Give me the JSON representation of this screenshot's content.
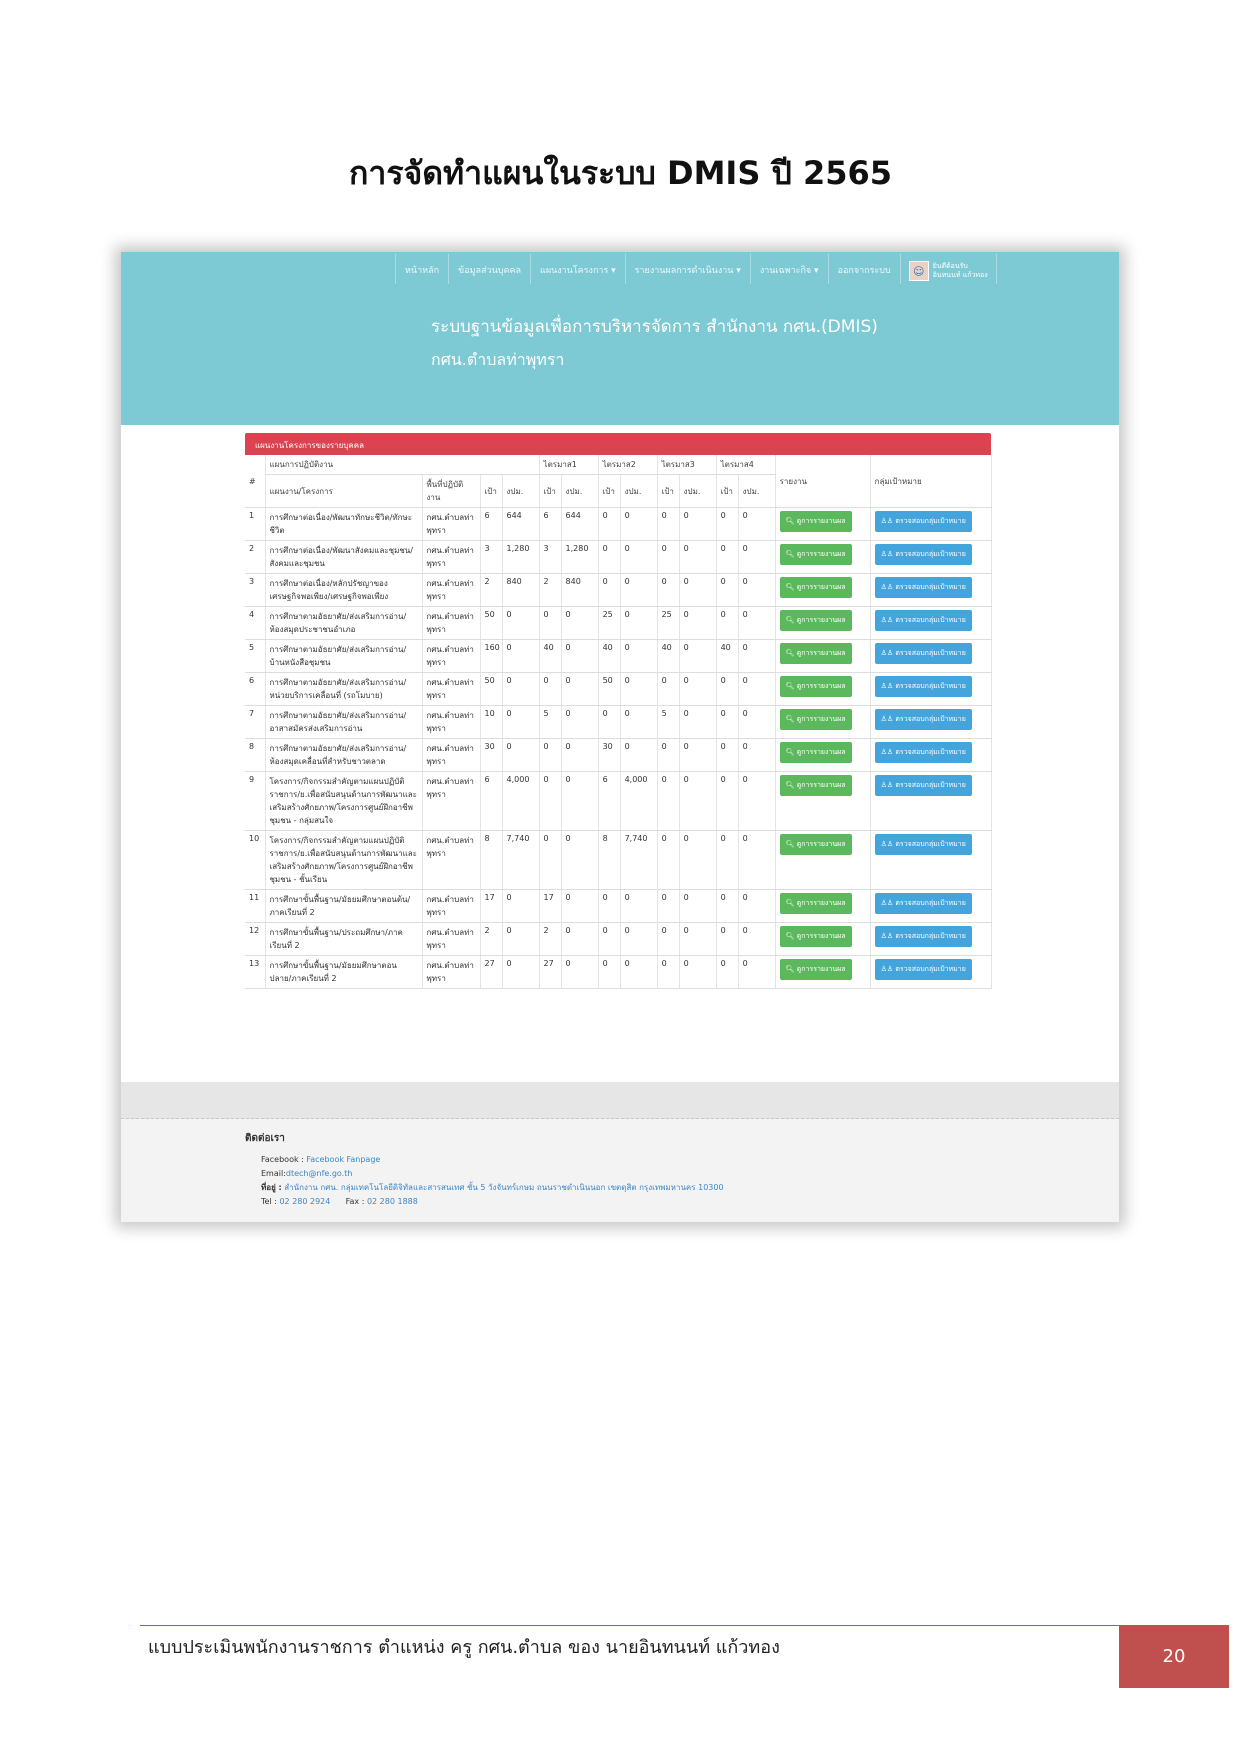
{
  "doc": {
    "title": "การจัดทำแผนในระบบ  DMIS ปี 2565",
    "footer_text": "แบบประเมินพนักงานราชการ ตำแหน่ง ครู กศน.ตำบล ของ นายอินทนนท์ แก้วทอง",
    "page_number": "20"
  },
  "nav": {
    "items": [
      "หน้าหลัก",
      "ข้อมูลส่วนบุคคล",
      "แผนงานโครงการ ▾",
      "รายงานผลการดำเนินงาน ▾",
      "งานเฉพาะกิจ ▾",
      "ออกจากระบบ"
    ],
    "user_line1": "ยินดีต้อนรับ",
    "user_line2": "อินทนนท์ แก้วทอง"
  },
  "hero": {
    "title": "ระบบฐานข้อมูลเพื่อการบริหารจัดการ สำนักงาน กศน.(DMIS)",
    "subtitle": "กศน.ตำบลท่าพุทรา"
  },
  "panel": {
    "title": "แผนงานโครงการของรายบุคคล",
    "headers": {
      "group": "แผนการปฏิบัติงาน",
      "q1": "ไตรมาส1",
      "q2": "ไตรมาส2",
      "q3": "ไตรมาส3",
      "q4": "ไตรมาส4",
      "num": "#",
      "project": "แผนงาน/โครงการ",
      "area": "พื้นที่ปฏิบัติงาน",
      "target": "เป้า",
      "budget": "งปม.",
      "report": "รายงาน",
      "target_group": "กลุ่มเป้าหมาย"
    },
    "report_button": "ดูการรายงานผล",
    "target_button": "ตรวจสอบกลุ่มเป้าหมาย",
    "rows": [
      {
        "n": "1",
        "project": "การศึกษาต่อเนื่อง/พัฒนาทักษะชีวิต/ทักษะชีวิต",
        "area": "กศน.ตำบลท่าพุทรา",
        "t": "6",
        "b": "644",
        "q1t": "6",
        "q1b": "644",
        "q2t": "0",
        "q2b": "0",
        "q3t": "0",
        "q3b": "0",
        "q4t": "0",
        "q4b": "0"
      },
      {
        "n": "2",
        "project": "การศึกษาต่อเนื่อง/พัฒนาสังคมและชุมชน/สังคมและชุมชน",
        "area": "กศน.ตำบลท่าพุทรา",
        "t": "3",
        "b": "1,280",
        "q1t": "3",
        "q1b": "1,280",
        "q2t": "0",
        "q2b": "0",
        "q3t": "0",
        "q3b": "0",
        "q4t": "0",
        "q4b": "0"
      },
      {
        "n": "3",
        "project": "การศึกษาต่อเนื่อง/หลักปรัชญาของเศรษฐกิจพอเพียง/เศรษฐกิจพอเพียง",
        "area": "กศน.ตำบลท่าพุทรา",
        "t": "2",
        "b": "840",
        "q1t": "2",
        "q1b": "840",
        "q2t": "0",
        "q2b": "0",
        "q3t": "0",
        "q3b": "0",
        "q4t": "0",
        "q4b": "0"
      },
      {
        "n": "4",
        "project": "การศึกษาตามอัธยาศัย/ส่งเสริมการอ่าน/ห้องสมุดประชาชนอำเภอ",
        "area": "กศน.ตำบลท่าพุทรา",
        "t": "50",
        "b": "0",
        "q1t": "0",
        "q1b": "0",
        "q2t": "25",
        "q2b": "0",
        "q3t": "25",
        "q3b": "0",
        "q4t": "0",
        "q4b": "0"
      },
      {
        "n": "5",
        "project": "การศึกษาตามอัธยาศัย/ส่งเสริมการอ่าน/บ้านหนังสือชุมชน",
        "area": "กศน.ตำบลท่าพุทรา",
        "t": "160",
        "b": "0",
        "q1t": "40",
        "q1b": "0",
        "q2t": "40",
        "q2b": "0",
        "q3t": "40",
        "q3b": "0",
        "q4t": "40",
        "q4b": "0"
      },
      {
        "n": "6",
        "project": "การศึกษาตามอัธยาศัย/ส่งเสริมการอ่าน/หน่วยบริการเคลื่อนที่ (รถโมบาย)",
        "area": "กศน.ตำบลท่าพุทรา",
        "t": "50",
        "b": "0",
        "q1t": "0",
        "q1b": "0",
        "q2t": "50",
        "q2b": "0",
        "q3t": "0",
        "q3b": "0",
        "q4t": "0",
        "q4b": "0"
      },
      {
        "n": "7",
        "project": "การศึกษาตามอัธยาศัย/ส่งเสริมการอ่าน/อาสาสมัครส่งเสริมการอ่าน",
        "area": "กศน.ตำบลท่าพุทรา",
        "t": "10",
        "b": "0",
        "q1t": "5",
        "q1b": "0",
        "q2t": "0",
        "q2b": "0",
        "q3t": "5",
        "q3b": "0",
        "q4t": "0",
        "q4b": "0"
      },
      {
        "n": "8",
        "project": "การศึกษาตามอัธยาศัย/ส่งเสริมการอ่าน/ห้องสมุดเคลื่อนที่สำหรับชาวตลาด",
        "area": "กศน.ตำบลท่าพุทรา",
        "t": "30",
        "b": "0",
        "q1t": "0",
        "q1b": "0",
        "q2t": "30",
        "q2b": "0",
        "q3t": "0",
        "q3b": "0",
        "q4t": "0",
        "q4b": "0"
      },
      {
        "n": "9",
        "project": "โครงการ/กิจกรรมสำคัญตามแผนปฏิบัติราชการ/ย.เพื่อสนับสนุนด้านการพัฒนาและเสริมสร้างศักยภาพ/โครงการศูนย์ฝึกอาชีพชุมชน - กลุ่มสนใจ",
        "area": "กศน.ตำบลท่าพุทรา",
        "t": "6",
        "b": "4,000",
        "q1t": "0",
        "q1b": "0",
        "q2t": "6",
        "q2b": "4,000",
        "q3t": "0",
        "q3b": "0",
        "q4t": "0",
        "q4b": "0"
      },
      {
        "n": "10",
        "project": "โครงการ/กิจกรรมสำคัญตามแผนปฏิบัติราชการ/ย.เพื่อสนับสนุนด้านการพัฒนาและเสริมสร้างศักยภาพ/โครงการศูนย์ฝึกอาชีพชุมชน - ชั้นเรียน",
        "area": "กศน.ตำบลท่าพุทรา",
        "t": "8",
        "b": "7,740",
        "q1t": "0",
        "q1b": "0",
        "q2t": "8",
        "q2b": "7,740",
        "q3t": "0",
        "q3b": "0",
        "q4t": "0",
        "q4b": "0"
      },
      {
        "n": "11",
        "project": "การศึกษาขั้นพื้นฐาน/มัธยมศึกษาตอนต้น/ภาคเรียนที่ 2",
        "area": "กศน.ตำบลท่าพุทรา",
        "t": "17",
        "b": "0",
        "q1t": "17",
        "q1b": "0",
        "q2t": "0",
        "q2b": "0",
        "q3t": "0",
        "q3b": "0",
        "q4t": "0",
        "q4b": "0"
      },
      {
        "n": "12",
        "project": "การศึกษาขั้นพื้นฐาน/ประถมศึกษา/ภาคเรียนที่ 2",
        "area": "กศน.ตำบลท่าพุทรา",
        "t": "2",
        "b": "0",
        "q1t": "2",
        "q1b": "0",
        "q2t": "0",
        "q2b": "0",
        "q3t": "0",
        "q3b": "0",
        "q4t": "0",
        "q4b": "0"
      },
      {
        "n": "13",
        "project": "การศึกษาขั้นพื้นฐาน/มัธยมศึกษาตอนปลาย/ภาคเรียนที่ 2",
        "area": "กศน.ตำบลท่าพุทรา",
        "t": "27",
        "b": "0",
        "q1t": "27",
        "q1b": "0",
        "q2t": "0",
        "q2b": "0",
        "q3t": "0",
        "q3b": "0",
        "q4t": "0",
        "q4b": "0"
      }
    ]
  },
  "contact": {
    "title": "ติดต่อเรา",
    "facebook_label": "Facebook :",
    "facebook_link": "Facebook Fanpage",
    "email_label": "Email:",
    "email": "dtech@nfe.go.th",
    "address_label": "ที่อยู่ :",
    "address": "สำนักงาน กศน. กลุ่มเทคโนโลยีดิจิทัลและสารสนเทศ ชั้น 5 วังจันทร์เกษม ถนนราชดำเนินนอก เขตดุสิต กรุงเทพมหานคร 10300",
    "tel_label": "Tel :",
    "tel": "02 280 2924",
    "fax_label": "Fax :",
    "fax": "02 280 1888"
  },
  "colors": {
    "hero_bg": "#7dc9d4",
    "panel_head": "#dc4350",
    "report_btn": "#5cb85c",
    "target_btn": "#44a4dc",
    "page_badge": "#c0504d"
  },
  "icons": {
    "report_btn": "search-icon",
    "target_btn": "users-icon"
  }
}
